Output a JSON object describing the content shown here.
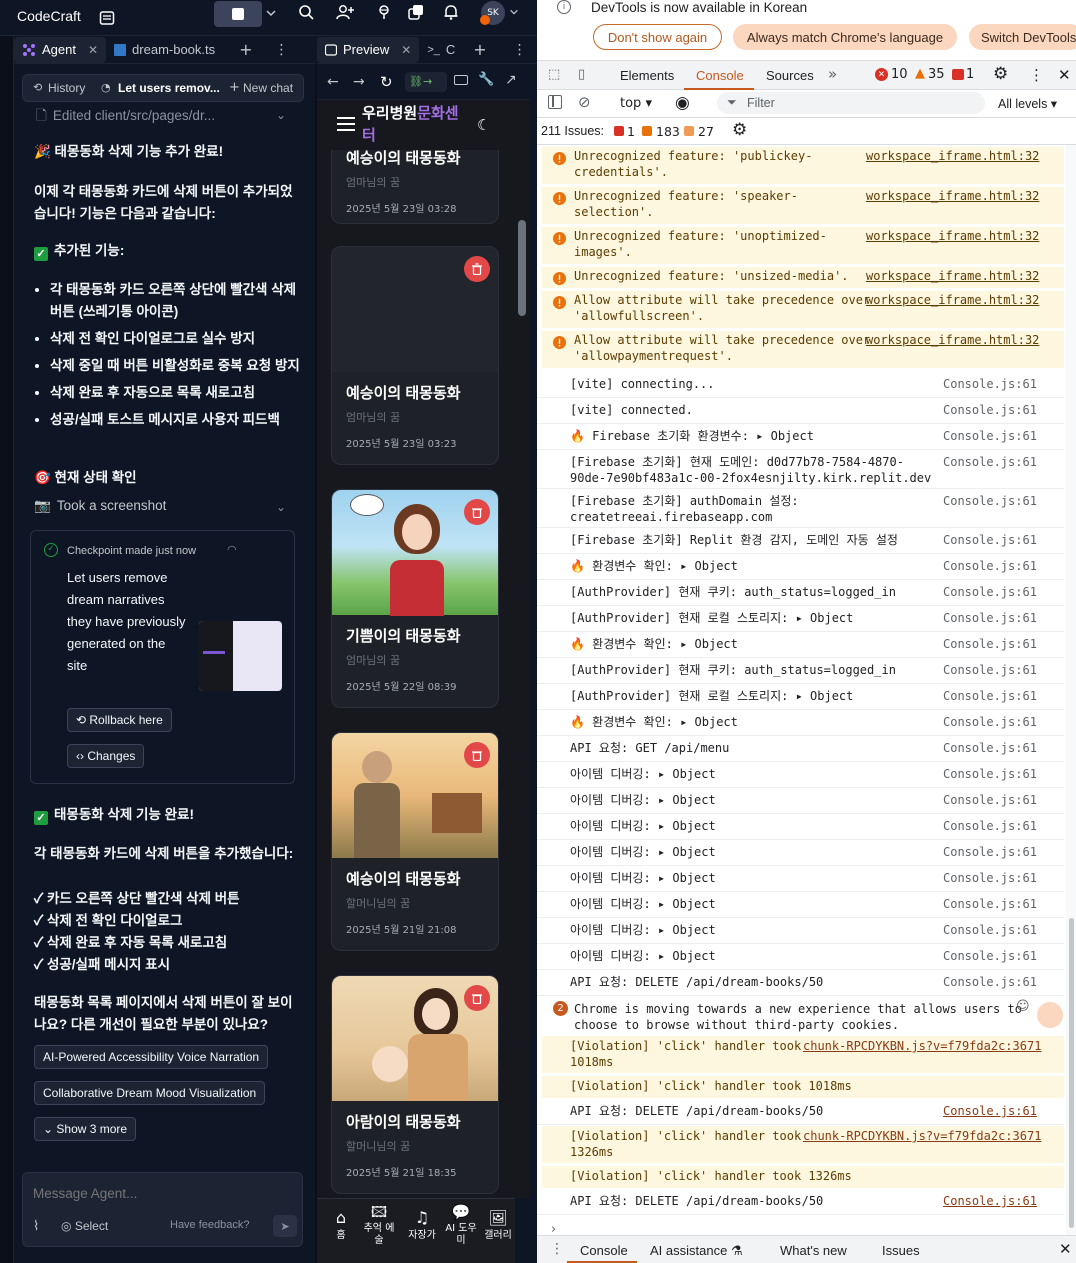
{
  "topbar": {
    "brand": "CodeCraft",
    "avatar": "SK"
  },
  "left_tabs": {
    "agent": "Agent",
    "file": "dream-book.ts"
  },
  "preview_tabs": {
    "preview": "Preview",
    "console": "C"
  },
  "agent_header": {
    "history": "History",
    "chat_title": "Let users remov...",
    "new_chat": "New chat"
  },
  "agent": {
    "edited": "Edited client/src/pages/dr...",
    "done_title": "🎉 태몽동화 삭제 기능 추가 완료!",
    "intro": "이제 각 태몽동화 카드에 삭제 버튼이 추가되었습니다! 기능은 다음과 같습니다:",
    "features_title": "추가된 기능:",
    "features": [
      "각 태몽동화 카드 오른쪽 상단에 빨간색 삭제 버튼 (쓰레기통 아이콘)",
      "삭제 전 확인 다이얼로그로 실수 방지",
      "삭제 중일 때 버튼 비활성화로 중복 요청 방지",
      "삭제 완료 후 자동으로 목록 새로고침",
      "성공/실패 토스트 메시지로 사용자 피드백"
    ],
    "status_title": "🎯 현재 상태 확인",
    "screenshot": "Took a screenshot",
    "checkpoint": {
      "label": "Checkpoint made just now",
      "desc": "Let users remove dream narratives they have previously generated on the site",
      "rollback": "Rollback here",
      "changes": "Changes"
    },
    "complete_title": "태몽동화 삭제 기능 완료!",
    "summary_intro": "각 태몽동화 카드에 삭제 버튼을 추가했습니다:",
    "summary": [
      "✓ 카드 오른쪽 상단 빨간색 삭제 버튼",
      "✓ 삭제 전 확인 다이얼로그",
      "✓ 삭제 완료 후 자동 목록 새로고침",
      "✓ 성공/실패 메시지 표시"
    ],
    "question": "태몽동화 목록 페이지에서 삭제 버튼이 잘 보이나요? 다른 개선이 필요한 부분이 있나요?",
    "suggestions": [
      "AI-Powered Accessibility Voice Narration",
      "Collaborative Dream Mood Visualization"
    ],
    "show_more": "Show 3 more",
    "input_placeholder": "Message Agent...",
    "select": "Select",
    "feedback": "Have feedback?"
  },
  "preview": {
    "site_title_a": "우리병원",
    "site_title_b": "문화센터",
    "cards": [
      {
        "title": "예승이의 태몽동화",
        "sub": "엄마님의 꿈",
        "date": "2025년 5월 23일 03:28"
      },
      {
        "title": "예승이의 태몽동화",
        "sub": "엄마님의 꿈",
        "date": "2025년 5월 23일 03:23"
      },
      {
        "title": "기쁨이의 태몽동화",
        "sub": "엄마님의 꿈",
        "date": "2025년 5월 22일 08:39"
      },
      {
        "title": "예승이의 태몽동화",
        "sub": "할머니님의 꿈",
        "date": "2025년 5월 21일 21:08"
      },
      {
        "title": "아람이의 태몽동화",
        "sub": "할머니님의 꿈",
        "date": "2025년 5월 21일 18:35"
      }
    ],
    "nav": [
      "홈",
      "추억 에술",
      "자장가",
      "AI 도우미",
      "갤러리"
    ]
  },
  "devtools": {
    "banner": "DevTools is now available in Korean",
    "btn_dont_show": "Don't show again",
    "btn_match": "Always match Chrome's language",
    "btn_switch": "Switch DevTools",
    "tabs": [
      "Elements",
      "Console",
      "Sources"
    ],
    "err_count": "10",
    "warn_count": "35",
    "issue_count": "1",
    "context": "top",
    "filter": "Filter",
    "levels": "All levels",
    "issues_label": "211 Issues:",
    "issues_err": "1",
    "issues_warn": "183",
    "issues_info": "27",
    "warnings": [
      {
        "msg": "Unrecognized feature: 'publickey-\ncredentials'.",
        "src": "workspace_iframe.html:32"
      },
      {
        "msg": "Unrecognized feature: 'speaker-\nselection'.",
        "src": "workspace_iframe.html:32"
      },
      {
        "msg": "Unrecognized feature: 'unoptimized-\nimages'.",
        "src": "workspace_iframe.html:32"
      },
      {
        "msg": "Unrecognized feature: 'unsized-media'.",
        "src": "workspace_iframe.html:32"
      },
      {
        "msg": "Allow attribute will take precedence over\n'allowfullscreen'.",
        "src": "workspace_iframe.html:32"
      },
      {
        "msg": "Allow attribute will take precedence over\n'allowpaymentrequest'.",
        "src": "workspace_iframe.html:32"
      }
    ],
    "logs": [
      {
        "msg": "[vite] connecting...",
        "src": "Console.js:61"
      },
      {
        "msg": "[vite] connected.",
        "src": "Console.js:61"
      },
      {
        "msg": "🔥 Firebase 초기화 환경변수: ▸ Object",
        "src": "Console.js:61"
      },
      {
        "msg": "[Firebase 초기화] 현재 도메인: d0d77b78-7584-4870-\n90de-7e90bf483a1c-00-2fox4esnjilty.kirk.replit.dev",
        "src": "Console.js:61"
      },
      {
        "msg": "[Firebase 초기화] authDomain 설정:\ncreatetreeai.firebaseapp.com",
        "src": "Console.js:61"
      },
      {
        "msg": "[Firebase 초기화] Replit 환경 감지, 도메인 자동 설정",
        "src": "Console.js:61"
      },
      {
        "msg": "🔥 환경변수 확인: ▸ Object",
        "src": "Console.js:61"
      },
      {
        "msg": "[AuthProvider] 현재 쿠키: auth_status=logged_in",
        "src": "Console.js:61"
      },
      {
        "msg": "[AuthProvider] 현재 로컬 스토리지: ▸ Object",
        "src": "Console.js:61"
      },
      {
        "msg": "🔥 환경변수 확인: ▸ Object",
        "src": "Console.js:61"
      },
      {
        "msg": "[AuthProvider] 현재 쿠키: auth_status=logged_in",
        "src": "Console.js:61"
      },
      {
        "msg": "[AuthProvider] 현재 로컬 스토리지: ▸ Object",
        "src": "Console.js:61"
      },
      {
        "msg": "🔥 환경변수 확인: ▸ Object",
        "src": "Console.js:61"
      },
      {
        "msg": "API 요청: GET /api/menu",
        "src": "Console.js:61"
      },
      {
        "msg": "아이템 디버깅: ▸ Object",
        "src": "Console.js:61"
      },
      {
        "msg": "아이템 디버깅: ▸ Object",
        "src": "Console.js:61"
      },
      {
        "msg": "아이템 디버깅: ▸ Object",
        "src": "Console.js:61"
      },
      {
        "msg": "아이템 디버깅: ▸ Object",
        "src": "Console.js:61"
      },
      {
        "msg": "아이템 디버깅: ▸ Object",
        "src": "Console.js:61"
      },
      {
        "msg": "아이템 디버깅: ▸ Object",
        "src": "Console.js:61"
      },
      {
        "msg": "아이템 디버깅: ▸ Object",
        "src": "Console.js:61"
      },
      {
        "msg": "아이템 디버깅: ▸ Object",
        "src": "Console.js:61"
      },
      {
        "msg": "API 요청: DELETE /api/dream-books/50",
        "src": "Console.js:61"
      }
    ],
    "chrome_msg": {
      "count": "2",
      "msg": "Chrome is moving towards a new experience that allows users to\nchoose to browse without third-party cookies."
    },
    "tail": [
      {
        "type": "warn",
        "msg": "[Violation] 'click' handler took\n1018ms",
        "src": "chunk-RPCDYKBN.js?v=f79fda2c:3671"
      },
      {
        "type": "warn",
        "msg": "[Violation] 'click' handler took 1018ms",
        "src": ""
      },
      {
        "type": "log",
        "msg": "API 요청: DELETE /api/dream-books/50",
        "src": "Console.js:61"
      },
      {
        "type": "warn",
        "msg": "[Violation] 'click' handler took\n1326ms",
        "src": "chunk-RPCDYKBN.js?v=f79fda2c:3671"
      },
      {
        "type": "warn",
        "msg": "[Violation] 'click' handler took 1326ms",
        "src": ""
      },
      {
        "type": "log",
        "msg": "API 요청: DELETE /api/dream-books/50",
        "src": "Console.js:61"
      }
    ],
    "drawer_tabs": [
      "Console",
      "AI assistance",
      "What's new",
      "Issues"
    ]
  }
}
